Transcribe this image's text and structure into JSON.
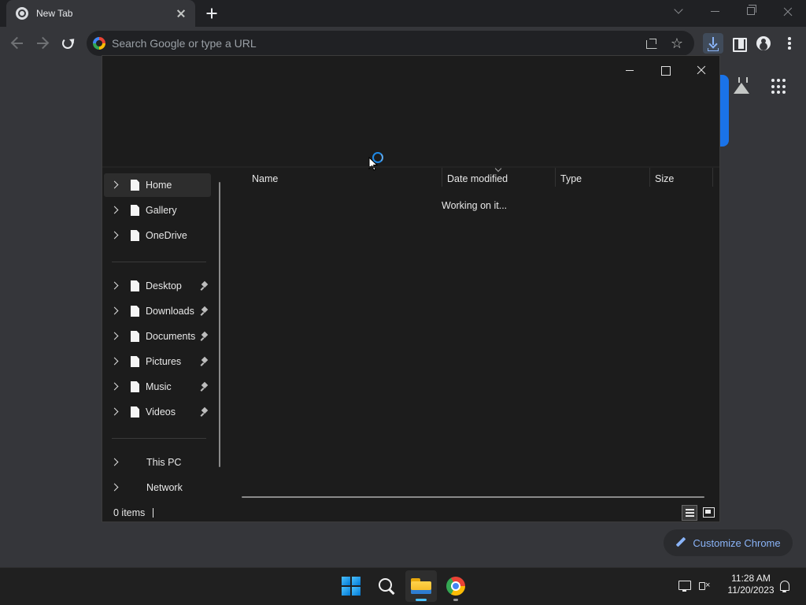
{
  "browser": {
    "tab": {
      "title": "New Tab",
      "favicon": "chrome-icon"
    },
    "omnibox": {
      "placeholder": "Search Google or type a URL"
    },
    "customize_label": "Customize Chrome",
    "colors": {
      "accent": "#8ab4f8",
      "brand_blue": "#1a73e8"
    }
  },
  "dialog": {
    "nav": {
      "quick": [
        {
          "label": "Home",
          "icon": "file-icon",
          "selected": true
        },
        {
          "label": "Gallery",
          "icon": "file-icon"
        },
        {
          "label": "OneDrive",
          "icon": "file-icon"
        }
      ],
      "pinned": [
        {
          "label": "Desktop",
          "icon": "file-icon",
          "pinned": true
        },
        {
          "label": "Downloads",
          "icon": "file-icon",
          "pinned": true
        },
        {
          "label": "Documents",
          "icon": "file-icon",
          "pinned": true
        },
        {
          "label": "Pictures",
          "icon": "file-icon",
          "pinned": true
        },
        {
          "label": "Music",
          "icon": "file-icon",
          "pinned": true
        },
        {
          "label": "Videos",
          "icon": "file-icon",
          "pinned": true
        }
      ],
      "devices": [
        {
          "label": "This PC"
        },
        {
          "label": "Network"
        }
      ]
    },
    "columns": [
      "Name",
      "Date modified",
      "Type",
      "Size"
    ],
    "status_message": "Working on it...",
    "item_count": "0 items"
  },
  "taskbar": {
    "apps": [
      "start-icon",
      "search-icon",
      "file-explorer-icon",
      "chrome-icon"
    ],
    "time": "11:28 AM",
    "date": "11/20/2023"
  }
}
